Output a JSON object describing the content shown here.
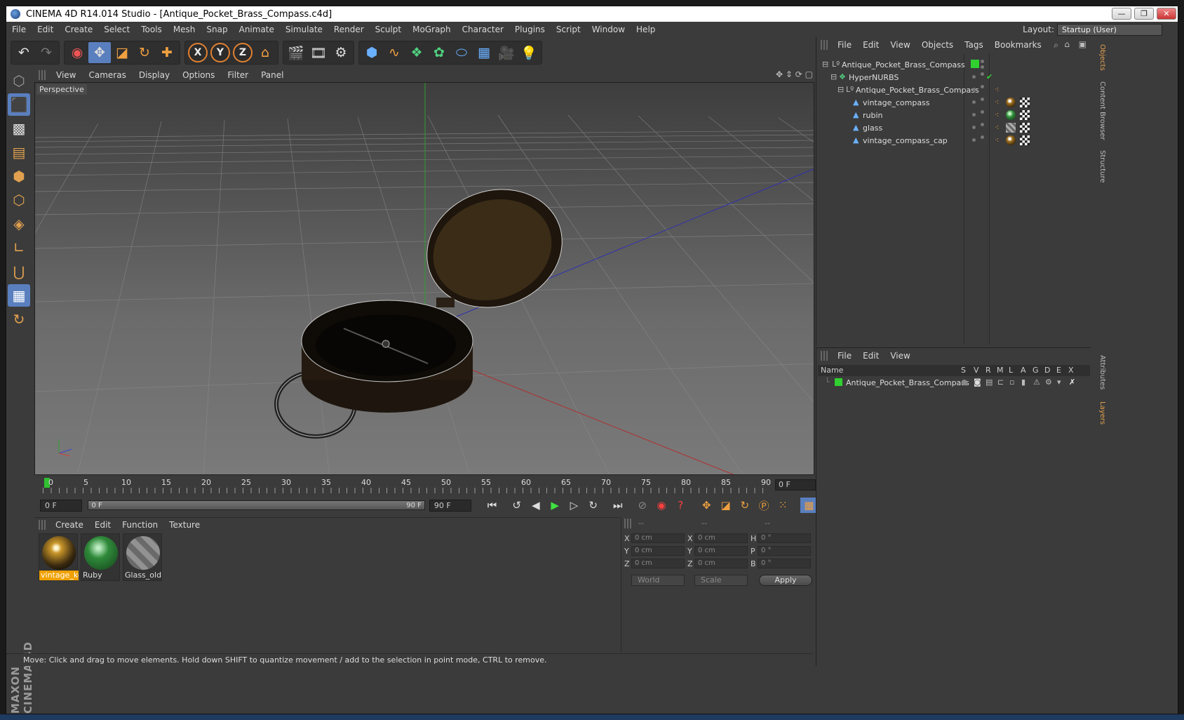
{
  "window": {
    "title": "CINEMA 4D R14.014 Studio - [Antique_Pocket_Brass_Compass.c4d]",
    "min_label": "—",
    "max_label": "❐",
    "close_label": "✕"
  },
  "menu": [
    "File",
    "Edit",
    "Create",
    "Select",
    "Tools",
    "Mesh",
    "Snap",
    "Animate",
    "Simulate",
    "Render",
    "Sculpt",
    "MoGraph",
    "Character",
    "Plugins",
    "Script",
    "Window",
    "Help"
  ],
  "layout": {
    "label": "Layout:",
    "value": "Startup (User)"
  },
  "toolbar": {
    "undo": "undo-icon",
    "redo": "redo-icon",
    "axis_x": "X",
    "axis_y": "Y",
    "axis_z": "Z"
  },
  "viewport": {
    "menu": [
      "View",
      "Cameras",
      "Display",
      "Options",
      "Filter",
      "Panel"
    ],
    "label": "Perspective"
  },
  "timeline": {
    "ticks": [
      "0",
      "5",
      "10",
      "15",
      "20",
      "25",
      "30",
      "35",
      "40",
      "45",
      "50",
      "55",
      "60",
      "65",
      "70",
      "75",
      "80",
      "85",
      "90"
    ],
    "current_frame": "0 F"
  },
  "transport": {
    "start": "0 F",
    "range_start": "0 F",
    "range_end": "90 F",
    "end": "90 F"
  },
  "materials": {
    "menu": [
      "Create",
      "Edit",
      "Function",
      "Texture"
    ],
    "items": [
      {
        "name": "vintage_ko",
        "color": "#c9962a"
      },
      {
        "name": "Ruby",
        "color": "#2f8a3a"
      },
      {
        "name": "Glass_old",
        "color": "#9a9a9a"
      }
    ]
  },
  "coordinates": {
    "headers": [
      "--",
      "--",
      "--"
    ],
    "rows": [
      {
        "a": "X",
        "av": "0 cm",
        "b": "X",
        "bv": "0 cm",
        "c": "H",
        "cv": "0 °"
      },
      {
        "a": "Y",
        "av": "0 cm",
        "b": "Y",
        "bv": "0 cm",
        "c": "P",
        "cv": "0 °"
      },
      {
        "a": "Z",
        "av": "0 cm",
        "b": "Z",
        "bv": "0 cm",
        "c": "B",
        "cv": "0 °"
      }
    ],
    "world": "World",
    "scale": "Scale",
    "apply": "Apply"
  },
  "status": "Move: Click and drag to move elements. Hold down SHIFT to quantize movement / add to the selection in point mode, CTRL to remove.",
  "objects": {
    "menu": [
      "File",
      "Edit",
      "View",
      "Objects",
      "Tags",
      "Bookmarks"
    ],
    "items": [
      {
        "name": "Antique_Pocket_Brass_Compass",
        "icon": "null-object-icon"
      },
      {
        "name": "HyperNURBS",
        "icon": "hypernurbs-icon"
      },
      {
        "name": "Antique_Pocket_Brass_Compass",
        "icon": "null-object-icon"
      },
      {
        "name": "vintage_compass",
        "icon": "polygon-object-icon"
      },
      {
        "name": "rubin",
        "icon": "polygon-object-icon"
      },
      {
        "name": "glass",
        "icon": "polygon-object-icon"
      },
      {
        "name": "vintage_compass_cap",
        "icon": "polygon-object-icon"
      }
    ]
  },
  "layers": {
    "menu": [
      "File",
      "Edit",
      "View"
    ],
    "columns": [
      "Name",
      "S",
      "V",
      "R",
      "M",
      "L",
      "A",
      "G",
      "D",
      "E",
      "X"
    ],
    "items": [
      {
        "name": "Antique_Pocket_Brass_Compass",
        "color": "#30d030"
      }
    ]
  },
  "side_tabs": [
    "Objects",
    "Content Browser",
    "Structure",
    "Attributes",
    "Layers"
  ],
  "brand": "MAXON CINEMA 4D",
  "colors": {
    "accent": "#5a7fbf",
    "selection": "#f0a000",
    "panel": "#3b3b3b"
  }
}
